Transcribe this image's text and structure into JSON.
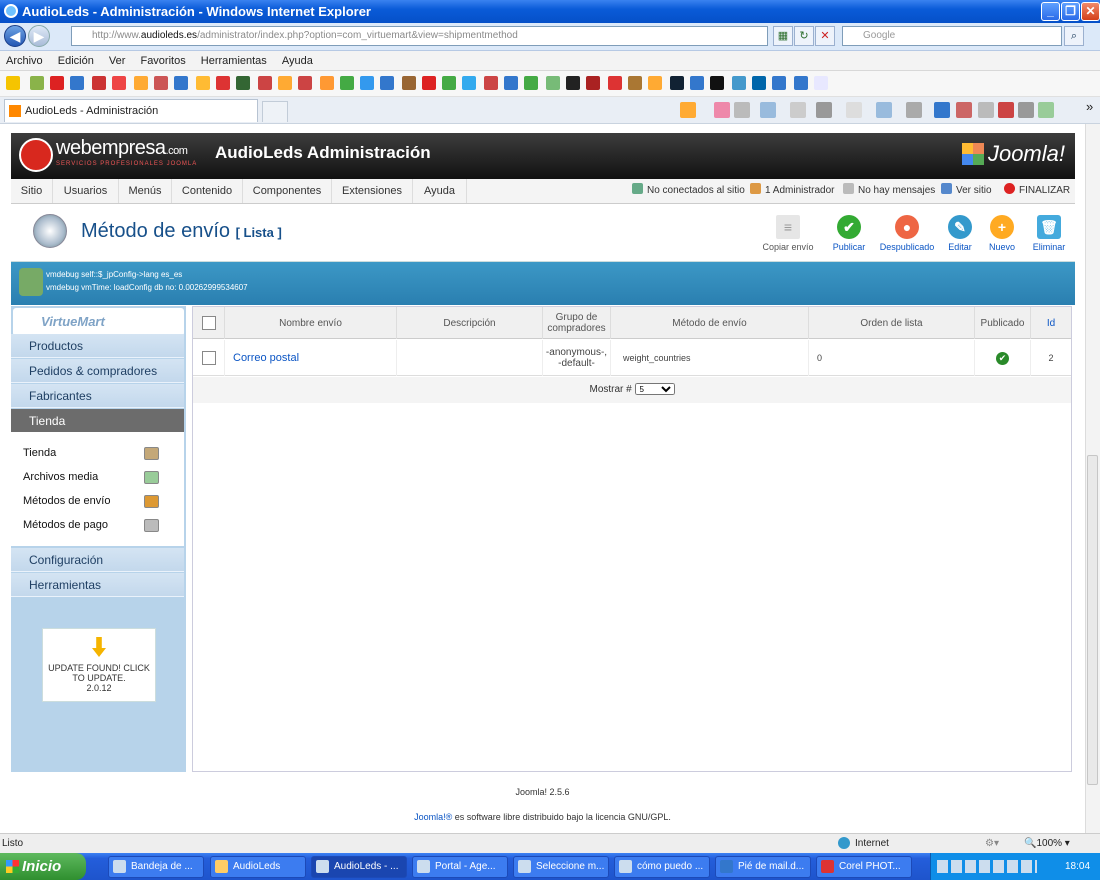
{
  "window": {
    "title": "AudioLeds - Administración - Windows Internet Explorer"
  },
  "address": {
    "prefix": "http://www.",
    "domain": "audioleds.es",
    "path": "/administrator/index.php?option=com_virtuemart&view=shipmentmethod",
    "search_placeholder": "Google"
  },
  "menubar": [
    "Archivo",
    "Edición",
    "Ver",
    "Favoritos",
    "Herramientas",
    "Ayuda"
  ],
  "tab": {
    "label": "AudioLeds - Administración"
  },
  "header": {
    "brand": "webempresa",
    "brand_suffix": ".com",
    "brand_sub": "SERVICIOS PROFESIONALES JOOMLA",
    "site_title": "AudioLeds Administración",
    "cms_logo": "Joomla!"
  },
  "jmenu": [
    "Sitio",
    "Usuarios",
    "Menús",
    "Contenido",
    "Componentes",
    "Extensiones",
    "Ayuda"
  ],
  "jstatus": {
    "offline": "No conectados al sitio",
    "admins": "1 Administrador",
    "messages": "No hay mensajes",
    "view_site": "Ver sitio",
    "logout": "FINALIZAR"
  },
  "page": {
    "title": "Método de envío",
    "subtitle": "[ Lista ]"
  },
  "toolbar": {
    "copy": "Copiar envío",
    "publish": "Publicar",
    "unpublish": "Despublicado",
    "edit": "Editar",
    "new": "Nuevo",
    "delete": "Eliminar"
  },
  "debug": {
    "line1": "vmdebug self::$_jpConfig->lang es_es",
    "line2": "vmdebug vmTime: loadConfig db no: 0.00262999534607"
  },
  "sidebar": {
    "logo": "VirtueMart",
    "cats": [
      "Productos",
      "Pedidos & compradores",
      "Fabricantes",
      "Tienda"
    ],
    "sub": [
      "Tienda",
      "Archivos media",
      "Métodos de envío",
      "Métodos de pago"
    ],
    "cats2": [
      "Configuración",
      "Herramientas"
    ],
    "update": {
      "line1": "UPDATE FOUND! CLICK",
      "line2": "TO UPDATE.",
      "version": "2.0.12"
    }
  },
  "table": {
    "headers": [
      "Nombre envío",
      "Descripción",
      "Grupo de compradores",
      "Método de envío",
      "Orden de lista",
      "Publicado",
      "Id"
    ],
    "row": {
      "name": "Correo postal",
      "description": "",
      "group": "-anonymous-, -default-",
      "method": "weight_countries",
      "order": "0",
      "id": "2"
    },
    "pager_label": "Mostrar #",
    "pager_value": "5"
  },
  "footer": {
    "version": "Joomla! 2.5.6",
    "license_link": "Joomla!®",
    "license_text": " es software libre distribuido bajo la licencia GNU/GPL."
  },
  "status": {
    "left": "Listo",
    "zone": "Internet",
    "zoom": "100%"
  },
  "taskbar": {
    "start": "Inicio",
    "tasks": [
      "Bandeja de ...",
      "AudioLeds",
      "AudioLeds - ...",
      "Portal - Age...",
      "Seleccione m...",
      "cómo puedo ...",
      "Pié de mail.d...",
      "Corel PHOT..."
    ],
    "clock": "18:04"
  }
}
